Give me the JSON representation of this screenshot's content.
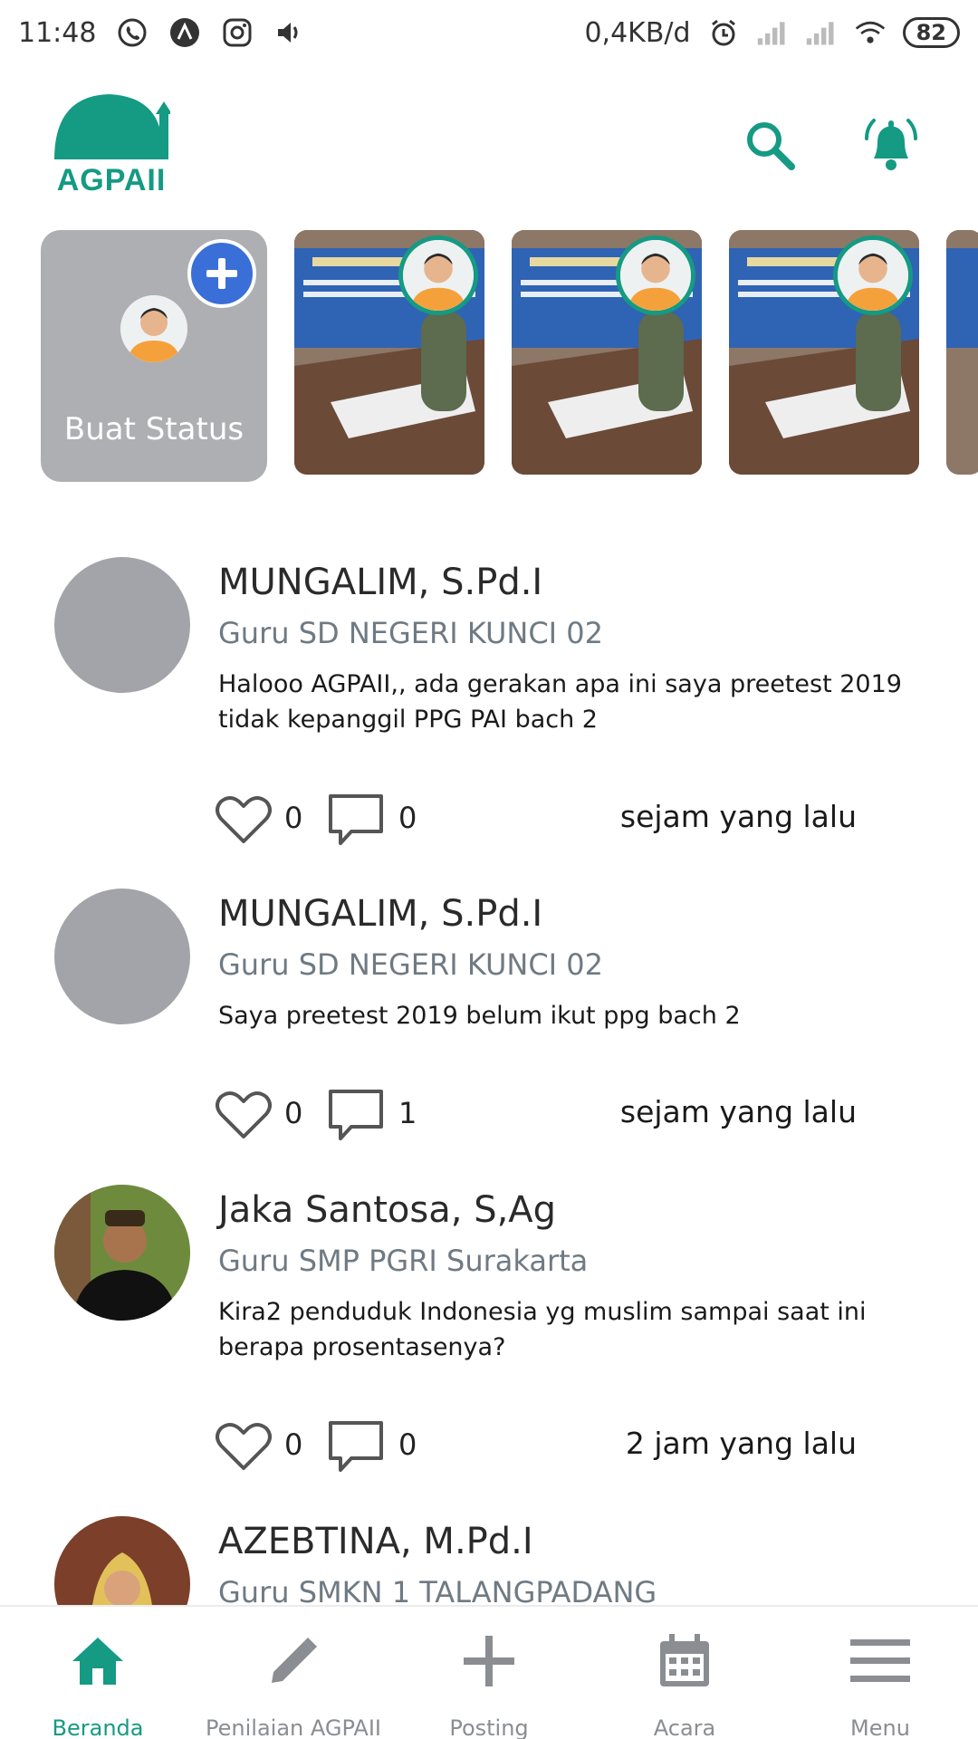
{
  "status_bar": {
    "time": "11:48",
    "network_speed": "0,4KB/d",
    "battery": "82"
  },
  "header": {
    "logo_text": "AGPAII"
  },
  "stories": {
    "create_label": "Buat Status"
  },
  "posts": [
    {
      "name": "MUNGALIM, S.Pd.I",
      "role": "Guru SD NEGERI KUNCI 02",
      "text": "Halooo AGPAII,, ada gerakan apa ini saya preetest 2019 tidak kepanggil PPG PAI bach 2",
      "likes": "0",
      "comments": "0",
      "time": "sejam yang lalu"
    },
    {
      "name": "MUNGALIM, S.Pd.I",
      "role": "Guru SD NEGERI KUNCI 02",
      "text": "Saya preetest 2019 belum ikut ppg bach 2",
      "likes": "0",
      "comments": "1",
      "time": "sejam yang lalu"
    },
    {
      "name": "Jaka Santosa, S,Ag",
      "role": "Guru SMP PGRI Surakarta",
      "text": "Kira2 penduduk Indonesia yg muslim sampai saat ini berapa prosentasenya?",
      "likes": "0",
      "comments": "0",
      "time": "2 jam yang lalu"
    },
    {
      "name": "AZEBTINA, M.Pd.I",
      "role": "Guru SMKN 1 TALANGPADANG"
    }
  ],
  "bottom_nav": [
    {
      "label": "Beranda",
      "icon": "home-icon",
      "active": true
    },
    {
      "label": "Penilaian AGPAII",
      "icon": "pencil-icon",
      "active": false
    },
    {
      "label": "Posting",
      "icon": "plus-icon",
      "active": false
    },
    {
      "label": "Acara",
      "icon": "calendar-icon",
      "active": false
    },
    {
      "label": "Menu",
      "icon": "hamburger-menu-icon",
      "active": false
    }
  ],
  "colors": {
    "brand": "#159a83",
    "story_bg": "#aeafb3",
    "plus_badge": "#3a6fd8",
    "avatar_placeholder": "#a3a4aa",
    "muted_text": "#6f7a83"
  }
}
